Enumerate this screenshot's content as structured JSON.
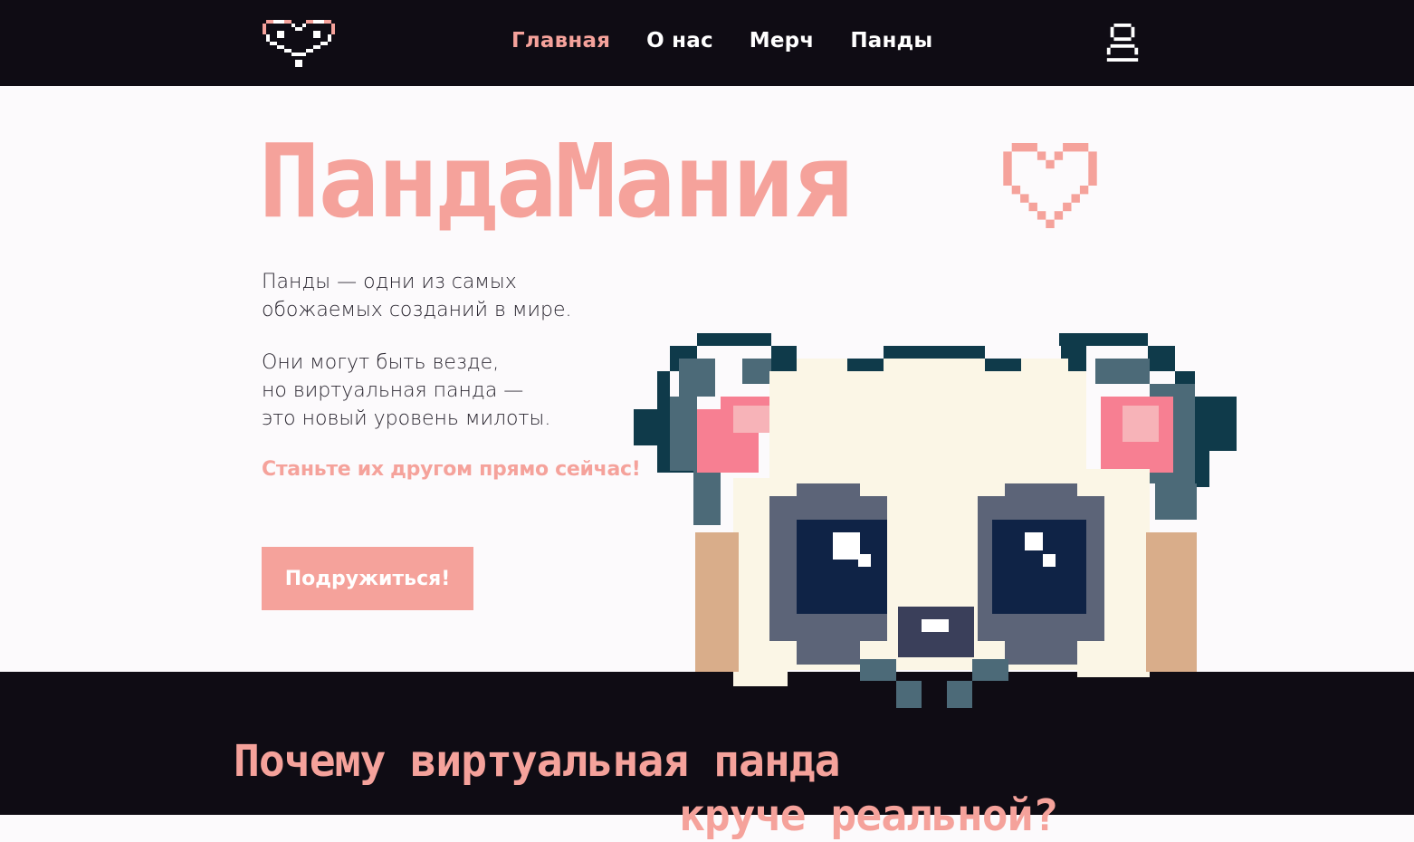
{
  "nav": {
    "items": [
      {
        "label": "Главная",
        "active": true
      },
      {
        "label": "О нас",
        "active": false
      },
      {
        "label": "Мерч",
        "active": false
      },
      {
        "label": "Панды",
        "active": false
      }
    ],
    "logo_icon": "pixel-heart-icon",
    "user_icon": "user-icon"
  },
  "hero": {
    "title": "ПандаМания",
    "title_icon": "pixel-heart-outline-icon",
    "paragraph1": [
      "Панды — одни из самых",
      "обожаемых созданий в мире."
    ],
    "paragraph2": [
      "Они могут быть везде,",
      "но виртуальная панда —",
      "это новый уровень милоты."
    ],
    "cta_text": "Станьте их другом прямо сейчас!",
    "button_label": "Подружиться!",
    "illustration": "pixel-panda-image"
  },
  "section2": {
    "heading_line1": "Почему виртуальная панда",
    "heading_line2": "круче реальной?"
  },
  "colors": {
    "accent": "#f5a29b",
    "dark": "#0f0c14",
    "background": "#fcfafc"
  }
}
